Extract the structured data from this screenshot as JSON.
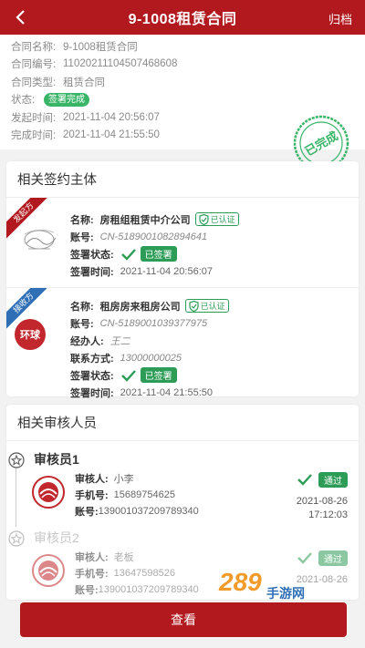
{
  "header": {
    "title": "9-1008租赁合同",
    "archive_label": "归档"
  },
  "info": {
    "rows": [
      {
        "key": "合同名称:",
        "value": "9-1008租赁合同"
      },
      {
        "key": "合同编号:",
        "value": "11020211104507468608"
      },
      {
        "key": "合同类型:",
        "value": "租赁合同"
      },
      {
        "key": "状态:",
        "badge": "签署完成"
      },
      {
        "key": "发起时间:",
        "value": "2021-11-04 20:56:07"
      },
      {
        "key": "完成时间:",
        "value": "2021-11-04 21:55:50"
      }
    ],
    "stamp_text": "已完成"
  },
  "parties": {
    "title": "相关签约主体",
    "initiator": {
      "ribbon": "发起方",
      "name_key": "名称:",
      "name": "房租组租赁中介公司",
      "auth": "已认证",
      "account_key": "账号:",
      "account": "CN-5189001082894641",
      "status_key": "签署状态:",
      "status": "已签署",
      "time_key": "签署时间:",
      "time": "2021-11-04 20:56:07"
    },
    "receiver": {
      "ribbon": "接收方",
      "logo_text": "环球",
      "name_key": "名称:",
      "name": "租房房来租房公司",
      "auth": "已认证",
      "account_key": "账号:",
      "account": "CN-5189001039377975",
      "agent_key": "经办人:",
      "agent": "王二",
      "contact_key": "联系方式:",
      "contact": "13000000025",
      "status_key": "签署状态:",
      "status": "已签署",
      "time_key": "签署时间:",
      "time": "2021-11-04 21:55:50"
    }
  },
  "reviewers": {
    "title": "相关审核人员",
    "items": [
      {
        "name": "审核员1",
        "reviewer_key": "审核人:",
        "reviewer": "小李",
        "phone_key": "手机号:",
        "phone": "15689754625",
        "account_key": "账号:",
        "account": "139001037209789340",
        "status": "通过",
        "date": "2021-08-26",
        "time": "17:12:03"
      },
      {
        "name": "审核员2",
        "reviewer_key": "审核人:",
        "reviewer": "老板",
        "phone_key": "手机号:",
        "phone": "13647598526",
        "account_key": "账号:",
        "account": "139001037209789340",
        "status": "通过",
        "date": "2021-08-26"
      }
    ]
  },
  "bottom": {
    "view_label": "查看"
  },
  "watermark": {
    "text": "289",
    "subtext": "手游网"
  },
  "colors": {
    "brand_red": "#b2191f",
    "green": "#2d9c57"
  }
}
